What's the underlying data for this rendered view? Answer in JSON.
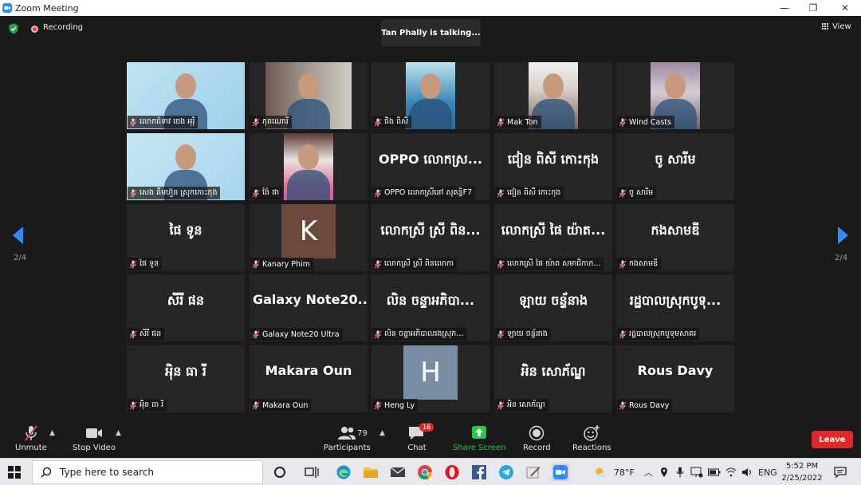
{
  "window": {
    "title": "Zoom Meeting",
    "minimize": "—",
    "restore": "❐",
    "close": "✕"
  },
  "header": {
    "recording": "Recording",
    "talking": "Tan Phally is talking...",
    "view": "View"
  },
  "pager": {
    "left": "2/4",
    "right": "2/4"
  },
  "tiles": [
    {
      "label": "លោកជំទាវ ចេង អុរ៉ី"
    },
    {
      "label": "ភុតណេារី"
    },
    {
      "label": "ជិង ពិសី"
    },
    {
      "label": "Mak Ton"
    },
    {
      "label": "Wind Casts"
    },
    {
      "label": "សេង គឹមហ៊ួន ស្រុកកោះកុង"
    },
    {
      "label": "ង៉ែ ផា"
    },
    {
      "center": "OPPO លោកស្រ...",
      "label": "OPPO លោកស្រីនៅ សុគន្ធិF7"
    },
    {
      "center": "ជៀន ពិសី កោះកុង",
      "label": "ជៀន ពិសី កោះកុង"
    },
    {
      "center": "ចូ សារីម",
      "label": "ចូ សារីម"
    },
    {
      "center": "ផៃ ទូន",
      "label": "ផៃ ទូន"
    },
    {
      "avatar": "K",
      "label": "Kanary Phim"
    },
    {
      "center": "លោកស្រី ស្រី ពិន...",
      "label": "លោកស្រី ស្រី ពិនលោកា"
    },
    {
      "center": "លោកស្រី ផៃ យ៉ាត...",
      "label": "លោកស្រី ផៃ យ៉ាត សមាជិកាក..."
    },
    {
      "center": "កងសាមឌី",
      "label": "កងសាមឌី"
    },
    {
      "center": "សីរី ផន",
      "label": "សីរី ផន"
    },
    {
      "center": "Galaxy Note20...",
      "label": "Galaxy Note20 Ultra"
    },
    {
      "center": "លិន ចន្ទាអភិបា...",
      "label": "លិន ចន្ទាអភិបាលរងស្រុក..."
    },
    {
      "center": "ឡាយ ចន្ទ័នាង",
      "label": "ឡាយ ចន្ទ័នាង"
    },
    {
      "center": "រដ្ឋបាលស្រុកបូទុ...",
      "label": "រដ្ឋបាលស្រុកបូទុមសាគរ"
    },
    {
      "center": "អុិន ធា រី",
      "label": "អុិន ធា រី"
    },
    {
      "center": "Makara Oun",
      "label": "Makara Oun"
    },
    {
      "avatar": "H",
      "label": "Heng Ly"
    },
    {
      "center": "អិន សោភ័ណ្ឌ",
      "label": "អិន សោភ័ណ្ឌ"
    },
    {
      "center": "Rous Davy",
      "label": "Rous Davy"
    }
  ],
  "toolbar": {
    "unmute": "Unmute",
    "stop_video": "Stop Video",
    "participants": "Participants",
    "participants_count": "79",
    "chat": "Chat",
    "chat_badge": "16",
    "share_screen": "Share Screen",
    "record": "Record",
    "reactions": "Reactions",
    "leave": "Leave"
  },
  "taskbar": {
    "search_placeholder": "Type here to search",
    "temperature": "78°F",
    "language": "ENG",
    "time": "5:52 PM",
    "date": "2/25/2022"
  },
  "colors": {
    "accent_blue": "#2d8cff",
    "leave_red": "#e02828",
    "share_green": "#28c840",
    "meeting_bg": "#1a1a1a",
    "tile_bg": "#262626"
  }
}
